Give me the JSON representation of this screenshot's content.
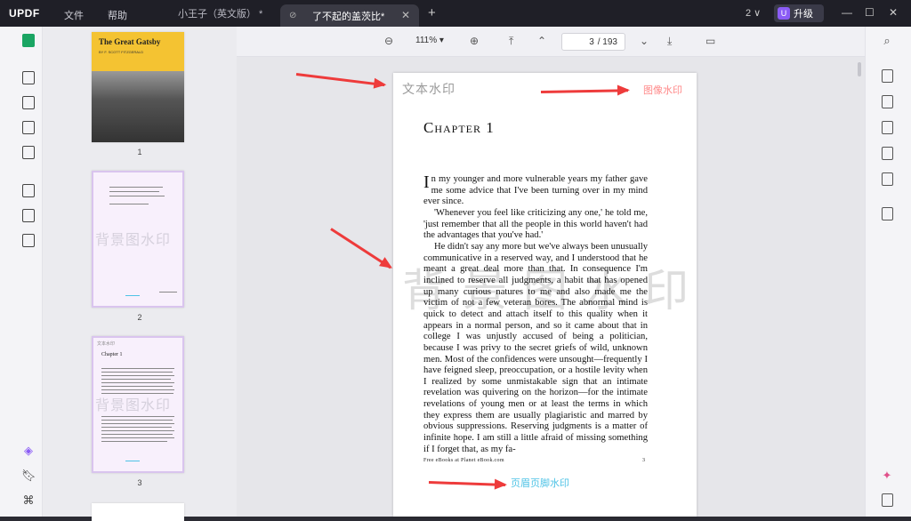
{
  "app": {
    "logo_main": "UPDF",
    "menu": [
      "文件",
      "帮助"
    ]
  },
  "tabs": [
    {
      "label": "小王子（英文版） *",
      "active": false
    },
    {
      "label": "了不起的盖茨比*",
      "active": true
    }
  ],
  "titlebar": {
    "tab_count": "2 ∨",
    "upgrade_label": "升级",
    "upgrade_badge": "U"
  },
  "toolbar": {
    "zoom": "111%",
    "current_page": "3",
    "total_pages": "/ 193"
  },
  "thumbnails": {
    "page1": {
      "label": "1",
      "title": "The Great Gatsby",
      "subtitle": "BY F. SCOTT FITZGERALD"
    },
    "page2": {
      "label": "2",
      "watermark": "背景图水印"
    },
    "page3": {
      "label": "3",
      "header_wm": "文本水印",
      "chapter": "Chapter 1",
      "watermark": "背景图水印"
    }
  },
  "page": {
    "text_watermark": "文本水印",
    "image_watermark": "图像水印",
    "background_watermark": "背景图水印",
    "chapter_title": "Chapter 1",
    "dropcap": "I",
    "paragraphs": [
      "n my younger and more vulnerable years my father gave me some advice that I've been turning over in my mind ever since.",
      "'Whenever you feel like criticizing any one,' he told me, 'just remember that all the people in this world haven't had the advantages that you've had.'",
      "He didn't say any more but we've always been unusually communicative in a reserved way, and I understood that he meant a great deal more than that. In consequence I'm inclined to reserve all judgments, a habit that has opened up many curious natures to me and also made me the victim of not a few veteran bores. The abnormal mind is quick to detect and attach itself to this quality when it appears in a normal person, and so it came about that in college I was unjustly accused of being a politician, because I was privy to the secret griefs of wild, unknown men. Most of the confidences were unsought—frequently I have feigned sleep, preoccupation, or a hostile levity when I realized by some unmistakable sign that an intimate revelation was quivering on the horizon—for the intimate revelations of young men or at least the terms in which they express them are usually plagiaristic and marred by obvious suppressions. Reserving judgments is a matter of infinite hope. I am still a little afraid of missing something if I forget that, as my fa-"
    ],
    "footer_left": "Free eBooks at Planet eBook.com",
    "footer_right": "3",
    "footer_watermark": "页眉页脚水印"
  },
  "colors": {
    "accent_green": "#1aa563",
    "arrow_red": "#ee3b3b",
    "image_wm_pink": "#ff8a8a",
    "footer_wm_cyan": "#4fc3e6"
  }
}
